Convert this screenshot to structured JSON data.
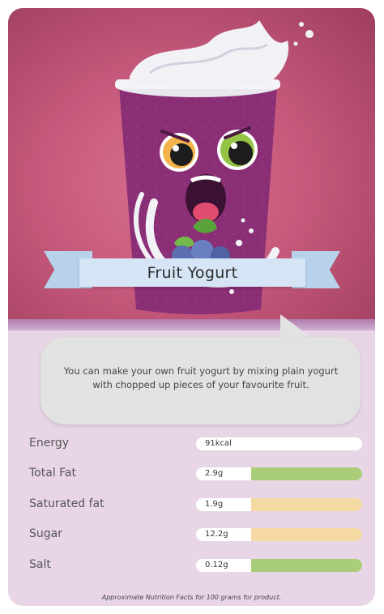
{
  "product": {
    "name": "Fruit Yogurt",
    "description": "You can make your own fruit yogurt by mixing plain yogurt with chopped up pieces of your favourite fruit."
  },
  "nutrition": [
    {
      "label": "Energy",
      "value": "91kcal",
      "color": "#ffffff"
    },
    {
      "label": "Total Fat",
      "value": "2.9g",
      "color": "#a9cd78"
    },
    {
      "label": "Saturated fat",
      "value": "1.9g",
      "color": "#f5d9a2"
    },
    {
      "label": "Sugar",
      "value": "12.2g",
      "color": "#f5d9a2"
    },
    {
      "label": "Salt",
      "value": "0.12g",
      "color": "#a9cd78"
    }
  ],
  "footnote": "Approximate Nutrition Facts for 100 grams for product.",
  "colors": {
    "background": "#c75a7c",
    "panel": "#e8d6e7",
    "banner": "#d6e5f5",
    "bubble": "#e2e2e2"
  },
  "illustration": {
    "icon": "yogurt-cup-character-icon"
  }
}
